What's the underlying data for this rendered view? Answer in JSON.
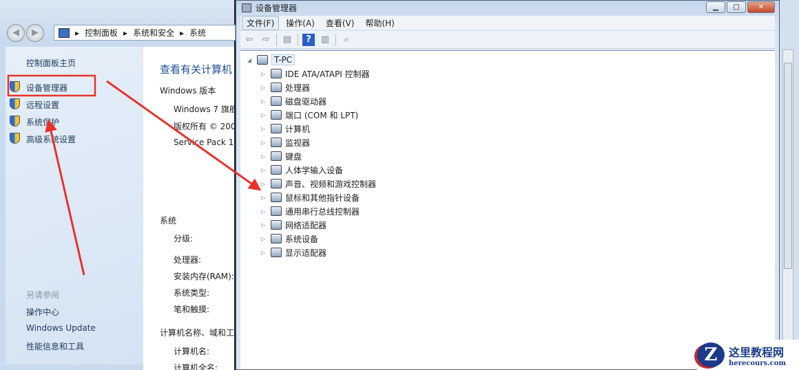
{
  "explorer": {
    "breadcrumb": [
      "控制面板",
      "系统和安全",
      "系统"
    ],
    "sidebar": {
      "home": "控制面板主页",
      "items": [
        "设备管理器",
        "远程设置",
        "系统保护",
        "高级系统设置"
      ],
      "see_also_title": "另请参阅",
      "see_also": [
        "操作中心",
        "Windows Update",
        "性能信息和工具"
      ]
    },
    "main": {
      "title": "查看有关计算机",
      "edition_header": "Windows 版本",
      "edition": "Windows 7 旗舰",
      "copyright": "版权所有 © 200",
      "service_pack": "Service Pack 1",
      "system_header": "系统",
      "system_fields": [
        "分级:",
        "处理器:",
        "安装内存(RAM):",
        "系统类型:",
        "笔和触摸:"
      ],
      "name_header": "计算机名称、域和工",
      "name_fields": [
        "计算机名:",
        "计算机全名:"
      ]
    }
  },
  "device_manager": {
    "title": "设备管理器",
    "menu": [
      "文件(F)",
      "操作(A)",
      "查看(V)",
      "帮助(H)"
    ],
    "root": "T-PC",
    "devices": [
      "IDE ATA/ATAPI 控制器",
      "处理器",
      "磁盘驱动器",
      "端口 (COM 和 LPT)",
      "计算机",
      "监视器",
      "键盘",
      "人体学输入设备",
      "声音、视频和游戏控制器",
      "鼠标和其他指针设备",
      "通用串行总线控制器",
      "网络适配器",
      "系统设备",
      "显示适配器"
    ]
  },
  "watermark": {
    "name": "这里教程网",
    "url": "herecours.com"
  },
  "annotation_color": "#e8322a"
}
